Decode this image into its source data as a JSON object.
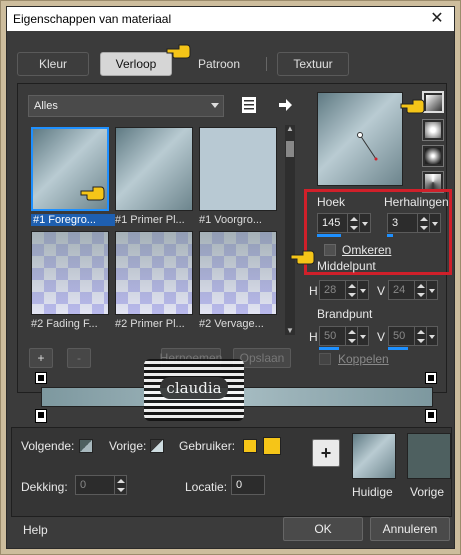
{
  "window": {
    "title": "Eigenschappen van materiaal",
    "close": "✕"
  },
  "tabs": [
    {
      "label": "Kleur",
      "active": false
    },
    {
      "label": "Verloop",
      "active": true
    },
    {
      "label": "Patroon",
      "active": false
    },
    {
      "label": "Textuur",
      "active": false
    }
  ],
  "category": {
    "value": "Alles"
  },
  "gradients": [
    {
      "caption": "#1 Foregro...",
      "fill": "grad-a",
      "selected": true
    },
    {
      "caption": "#1 Primer Pl...",
      "fill": "grad-a",
      "selected": false
    },
    {
      "caption": "#1 Voorgro...",
      "fill": "grad-c",
      "selected": false
    },
    {
      "caption": "#2 Fading F...",
      "fill": "checker",
      "selected": false
    },
    {
      "caption": "#2 Primer Pl...",
      "fill": "checker",
      "selected": false
    },
    {
      "caption": "#2 Vervage...",
      "fill": "checker",
      "selected": false
    }
  ],
  "list_buttons": {
    "add": "+",
    "remove": "-",
    "rename": "Hernoemen",
    "edit": "Opslaan"
  },
  "settings": {
    "angle_label": "Hoek",
    "angle_value": "145",
    "repeats_label": "Herhalingen",
    "repeats_value": "3",
    "invert_label": "Omkeren",
    "center_label": "Middelpunt",
    "h_label": "H",
    "center_h": "28",
    "v_label": "V",
    "center_v": "24",
    "focal_label": "Brandpunt",
    "focal_h": "50",
    "focal_v": "50",
    "link_label": "Koppelen"
  },
  "bottom": {
    "next_label": "Volgende:",
    "prev_label": "Vorige:",
    "user_label": "Gebruiker:",
    "opacity_label": "Dekking:",
    "opacity_value": "0",
    "location_label": "Locatie:",
    "location_value": "0",
    "add_button": "+",
    "current_label": "Huidige",
    "previous_label": "Vorige"
  },
  "footer": {
    "help": "Help",
    "ok": "OK",
    "cancel": "Annuleren"
  },
  "watermark": {
    "text": "claudia"
  },
  "colors": {
    "accent": "#1e90ff",
    "highlight_box": "#d0202a",
    "user_color": "#f5c518",
    "previous_color": "#4e6060"
  },
  "icons": [
    "close-icon",
    "hand-pointer-icon",
    "list-view-icon",
    "arrow-right-icon",
    "gradient-style-icon",
    "marker-icon",
    "add-icon"
  ]
}
